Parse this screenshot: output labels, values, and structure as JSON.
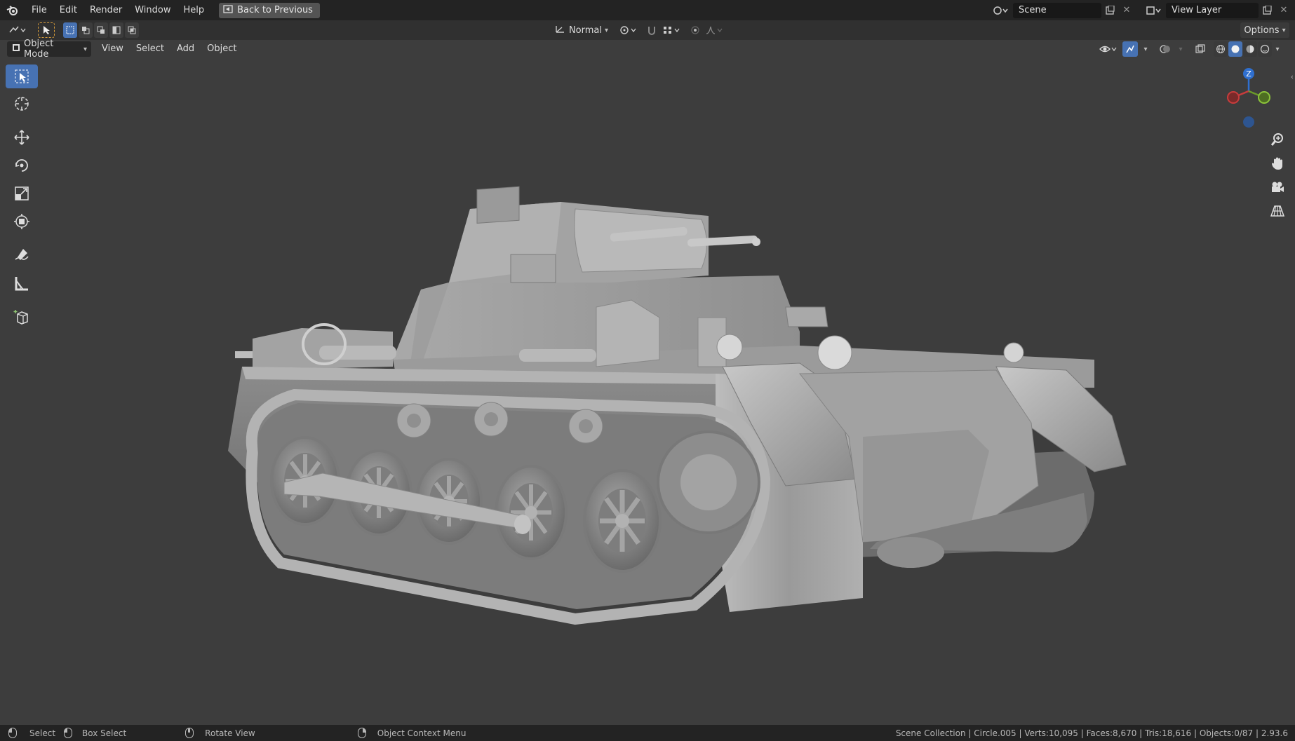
{
  "menu": {
    "items": [
      "File",
      "Edit",
      "Render",
      "Window",
      "Help"
    ],
    "back_button": "Back to Previous"
  },
  "scene": {
    "name": "Scene",
    "view_layer": "View Layer"
  },
  "tool_header": {
    "orientation": "Normal",
    "options": "Options"
  },
  "view_header": {
    "mode": "Object Mode",
    "menus": [
      "View",
      "Select",
      "Add",
      "Object"
    ]
  },
  "status": {
    "select": "Select",
    "box_select": "Box Select",
    "rotate_view": "Rotate View",
    "context_menu": "Object Context Menu",
    "stats": "Scene Collection | Circle.005 | Verts:10,095 | Faces:8,670 | Tris:18,616 | Objects:0/87 | 2.93.6"
  },
  "gizmo": {
    "z_label": "Z"
  },
  "colors": {
    "accent": "#4772b3",
    "axis_x": "#c83c3c",
    "axis_y": "#6a9a2a",
    "axis_z": "#2f6fcf"
  }
}
